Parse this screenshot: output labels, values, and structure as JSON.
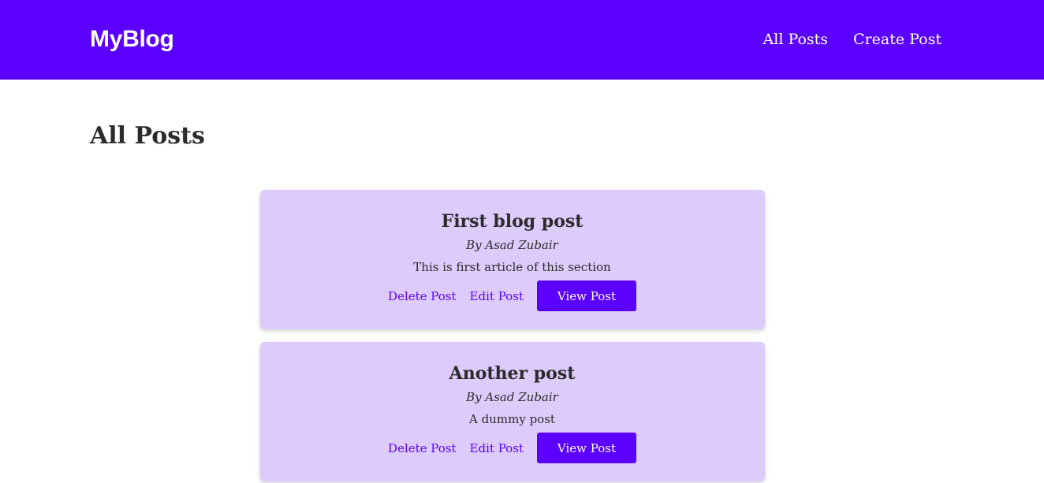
{
  "navbar": {
    "brand": "MyBlog",
    "links": [
      {
        "label": "All Posts"
      },
      {
        "label": "Create Post"
      }
    ]
  },
  "main": {
    "title": "All Posts",
    "posts": [
      {
        "title": "First blog post",
        "author": "By Asad Zubair",
        "body": "This is first article of this section",
        "delete_label": "Delete Post",
        "edit_label": "Edit Post",
        "view_label": "View Post"
      },
      {
        "title": "Another post",
        "author": "By Asad Zubair",
        "body": "A dummy post",
        "delete_label": "Delete Post",
        "edit_label": "Edit Post",
        "view_label": "View Post"
      }
    ]
  },
  "colors": {
    "brand": "#5b00ff",
    "card_bg": "#dccbfb",
    "text": "#2b2b2b"
  }
}
